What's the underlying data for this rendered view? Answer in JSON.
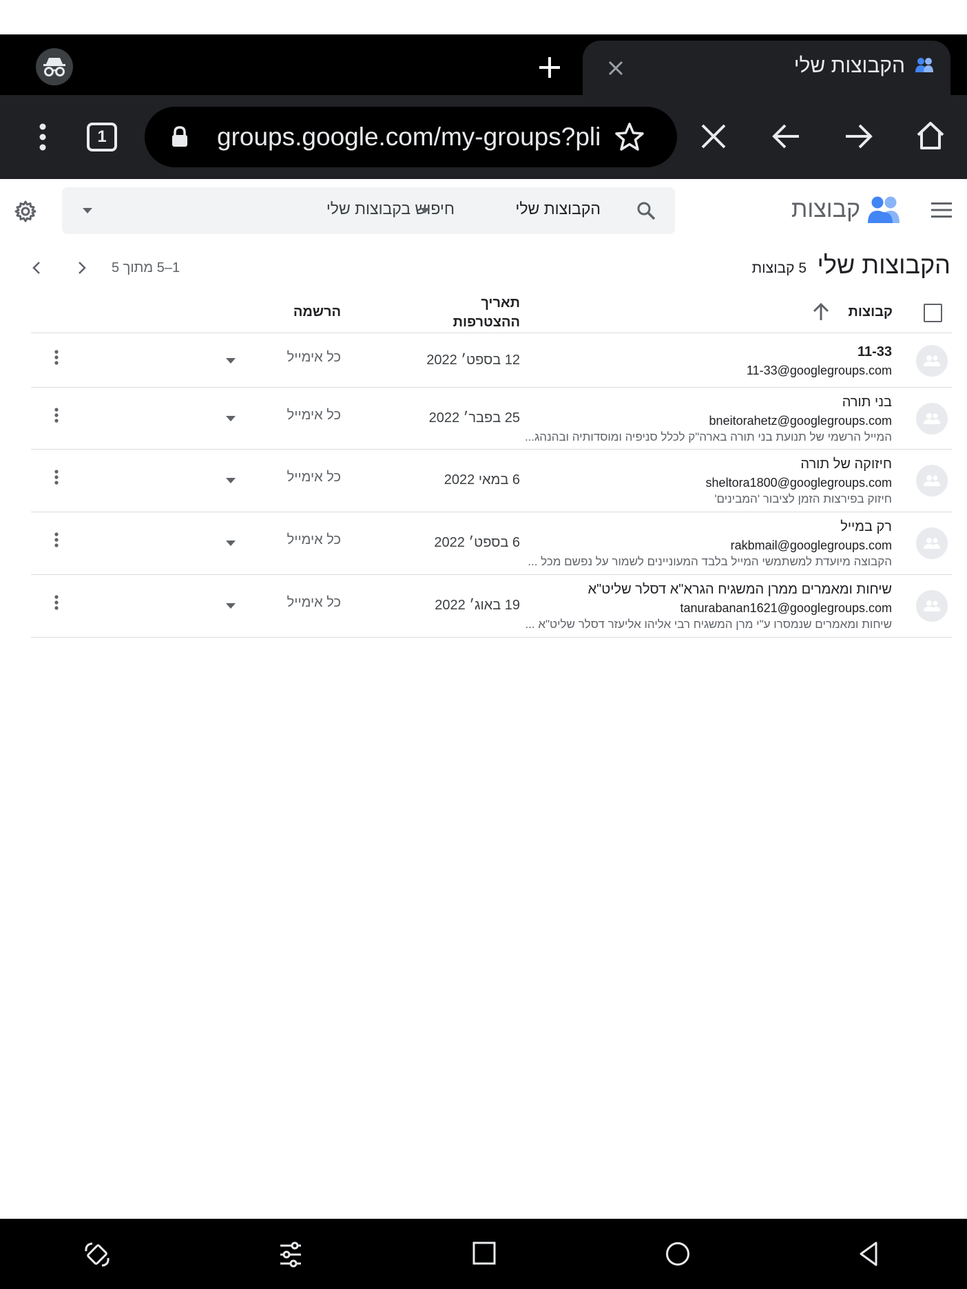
{
  "browser": {
    "tab_title": "הקבוצות שלי",
    "tab_count": "1",
    "url": "groups.google.com/my-groups?pli="
  },
  "app": {
    "brand": "קבוצות",
    "search_scope": "הקבוצות שלי",
    "search_placeholder": "חיפוש בקבוצות שלי"
  },
  "page": {
    "title": "הקבוצות שלי",
    "count_label": "5 קבוצות",
    "pagination": "1–5 מתוך 5"
  },
  "table": {
    "headers": {
      "groups": "קבוצות",
      "joined_line1": "תאריך",
      "joined_line2": "ההצטרפות",
      "subscription": "הרשמה"
    },
    "rows": [
      {
        "name": "11-33",
        "email": "11-33@googlegroups.com",
        "description": "",
        "joined": "12 בספט׳ 2022",
        "subscription": "כל אימייל"
      },
      {
        "name": "בני תורה",
        "email": "bneitorahetz@googlegroups.com",
        "description": "המייל הרשמי של תנועת בני תורה בארה\"ק לכלל סניפיה ומוסדותיה ובהנהג...",
        "joined": "25 בפבר׳ 2022",
        "subscription": "כל אימייל"
      },
      {
        "name": "חיזוקה של תורה",
        "email": "sheltora1800@googlegroups.com",
        "description": "חיזוק בפירצות הזמן לציבור 'המבינים'",
        "joined": "6 במאי 2022",
        "subscription": "כל אימייל"
      },
      {
        "name": "רק במייל",
        "email": "rakbmail@googlegroups.com",
        "description": "הקבוצה מיועדת למשתמשי המייל בלבד המעוניינים לשמור על נפשם מכל ...",
        "joined": "6 בספט׳ 2022",
        "subscription": "כל אימייל"
      },
      {
        "name": "שיחות ומאמרים ממרן המשגיח הגרא\"א דסלר שליט\"א",
        "email": "tanurabanan1621@googlegroups.com",
        "description": "שיחות ומאמרים שנמסרו ע\"י מרן המשגיח רבי אליהו אליעזר דסלר שליט\"א ...",
        "joined": "19 באוג׳ 2022",
        "subscription": "כל אימייל"
      }
    ]
  },
  "colors": {
    "brand_blue": "#4285f4",
    "chrome_dark": "#202124",
    "search_bg": "#f1f3f4"
  }
}
